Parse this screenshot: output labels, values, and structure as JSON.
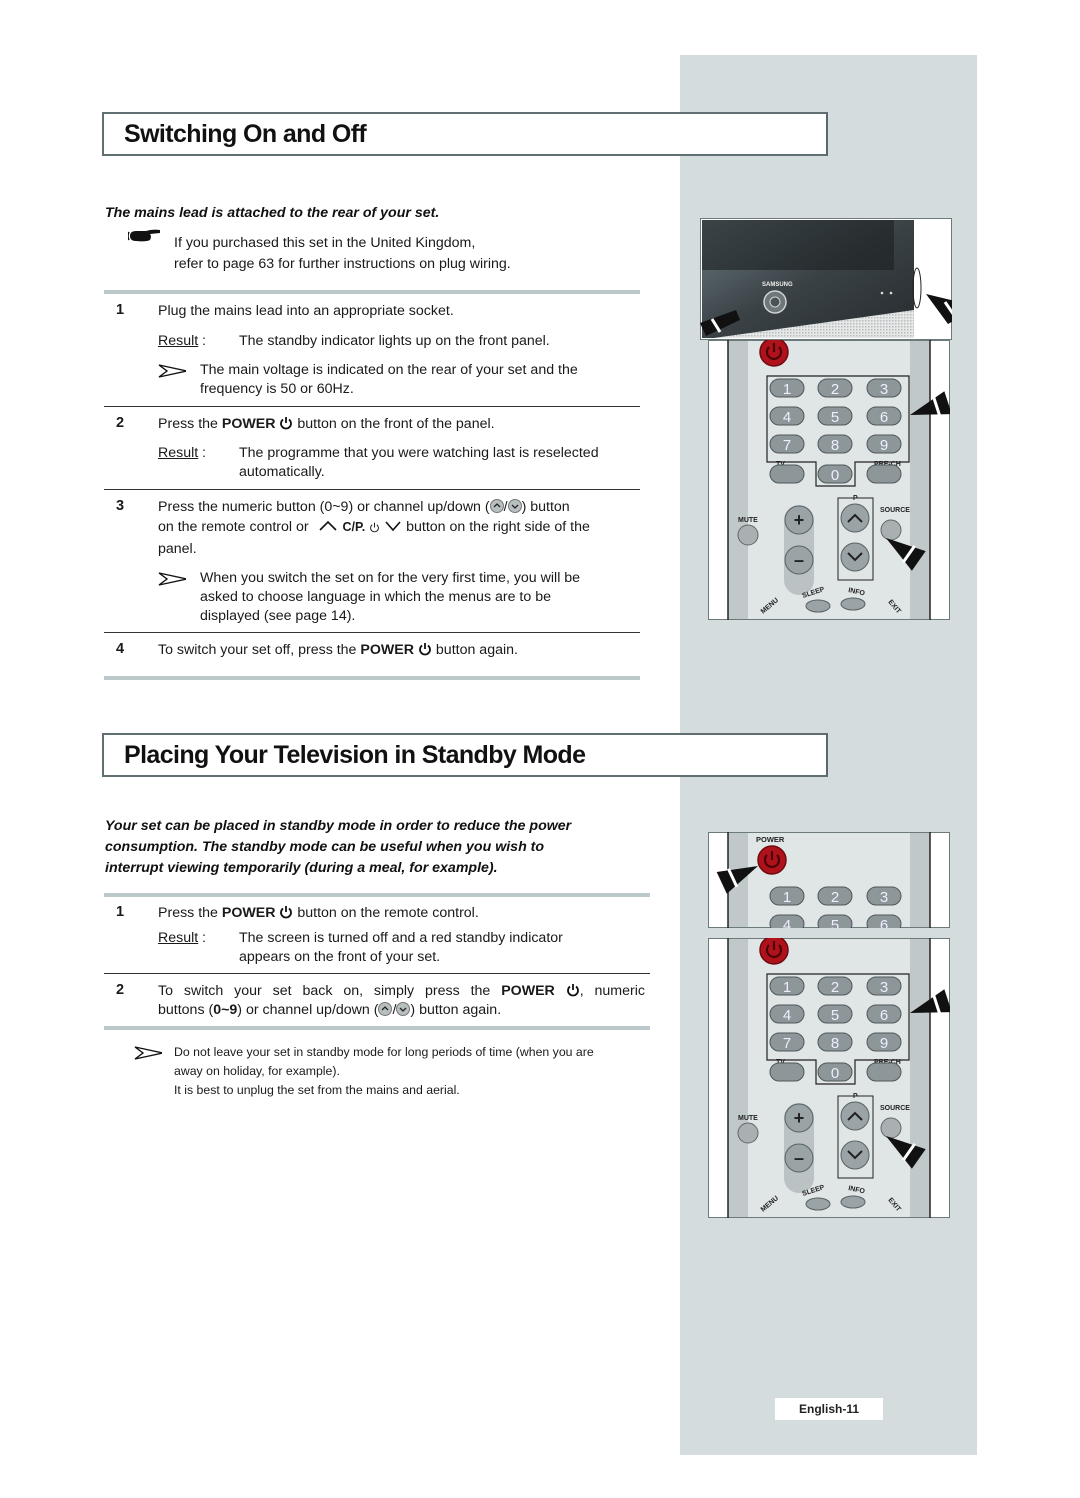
{
  "sections": [
    {
      "title": "Switching On and Off",
      "intro": "The mains lead is attached to the rear of your set.",
      "note_uk": [
        "If you purchased this set in the United Kingdom,",
        "refer to page 63 for further instructions on plug wiring."
      ],
      "steps": [
        {
          "number": "1",
          "text": "Plug the mains lead into an appropriate socket.",
          "result_label": "Result",
          "result": "The standby indicator lights up on the front panel.",
          "note": [
            "The main voltage is indicated on the rear of your set and the",
            "frequency is 50 or 60Hz."
          ]
        },
        {
          "number": "2",
          "text_before": "Press the ",
          "bold": "POWER",
          "text_after": " button on the front of the panel.",
          "result_label": "Result",
          "result": [
            "The programme that you were watching last is reselected",
            "automatically."
          ]
        },
        {
          "number": "3",
          "line1_before": "Press the numeric button (0~9) or channel up/down (",
          "line1_after": ") button",
          "line2_before": "on the remote control or",
          "panel_button_label": "C/P.",
          "line2_after": "button on the right side of the",
          "line3": "panel.",
          "note": [
            "When you switch the set on for the very first time, you will be",
            "asked to choose language in which the menus are to be",
            "displayed (see page 14)."
          ]
        },
        {
          "number": "4",
          "text_before": "To switch your set off, press the ",
          "bold": "POWER",
          "text_after": " button again."
        }
      ]
    },
    {
      "title": "Placing Your Television in Standby Mode",
      "intro": [
        "Your set can be placed in standby mode in order to reduce the power",
        "consumption. The standby mode can be useful when you wish to",
        "interrupt viewing temporarily (during a meal, for example)."
      ],
      "steps": [
        {
          "number": "1",
          "text_before": "Press the ",
          "bold": "POWER",
          "text_after": " button on the remote control.",
          "result_label": "Result",
          "result": [
            "The screen is turned off and a red standby indicator",
            "appears on the front of your set."
          ]
        },
        {
          "number": "2",
          "line1_before": "To switch your set back on, simply press the ",
          "bold": "POWER",
          "line1_after": ", numeric",
          "line2_before": "buttons (",
          "line2_bold": "0~9",
          "line2_mid": ") or channel up/down (",
          "line2_after": ") button again."
        }
      ],
      "note": [
        "Do not leave your set in standby mode for long periods of time (when you are",
        "away on holiday, for example).",
        "It is best to unplug the set from the mains and aerial."
      ]
    }
  ],
  "figures": {
    "tv_brand": "SAMSUNG",
    "remote": {
      "power_label": "POWER",
      "digits": [
        "1",
        "2",
        "3",
        "4",
        "5",
        "6",
        "7",
        "8",
        "9",
        "0"
      ],
      "tv_label": "TV",
      "prech_label": "PRE-CH",
      "mute_label": "MUTE",
      "p_label": "P",
      "source_label": "SOURCE",
      "sleep_label": "SLEEP",
      "info_label": "INFO",
      "menu_label": "MENU",
      "exit_label": "EXIT"
    }
  },
  "footer": {
    "page_label": "English-11"
  },
  "colors": {
    "side_panel": "#d4dcde",
    "rule": "#bcc9cb",
    "power_red": "#b0121c"
  }
}
